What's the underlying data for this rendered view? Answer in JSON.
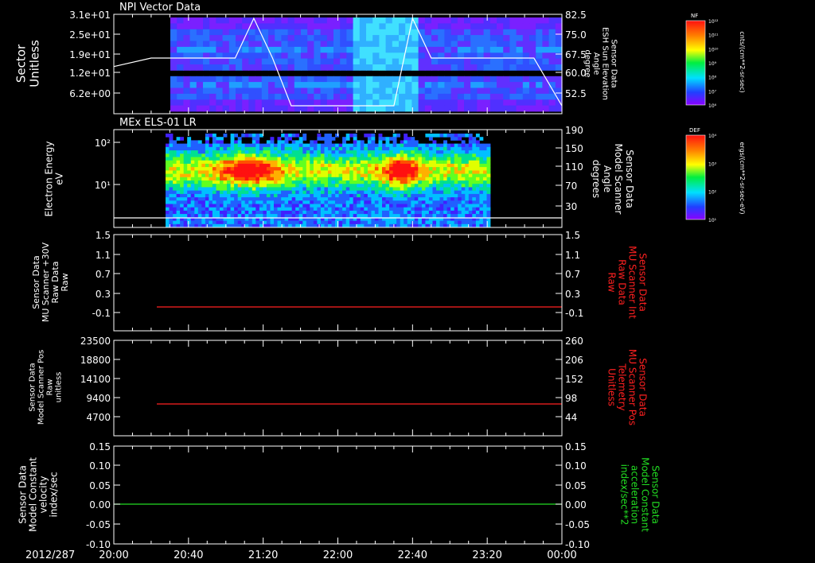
{
  "colors": {
    "background": "#000000",
    "axis": "#ffffff",
    "red_trace": "#ff2020",
    "green_trace": "#22dd22",
    "white_trace": "#ffffff"
  },
  "time_axis": {
    "date_label": "2012/287",
    "range": [
      "20:00",
      "00:00"
    ],
    "tick_labels": [
      "20:00",
      "20:40",
      "21:20",
      "22:00",
      "22:40",
      "23:20",
      "00:00"
    ]
  },
  "chart_data": [
    {
      "type": "heatmap",
      "title": "NPI Vector Data",
      "ylabel": "Sector\nUnitless",
      "y_ticks": [
        "3.1e+01",
        "2.5e+01",
        "1.9e+01",
        "1.2e+01",
        "6.2e+00"
      ],
      "y2label": "Sensor Data\nESH Sun Elevation\nAngle\ndegree",
      "y2_ticks": [
        "82.5",
        "75.0",
        "67.5",
        "60.0",
        "52.5"
      ],
      "overlay_line": {
        "color": "#ffffff",
        "description_points": [
          [
            "20:00",
            62.8
          ],
          [
            "20:20",
            66.0
          ],
          [
            "21:05",
            66.0
          ],
          [
            "21:15",
            81.0
          ],
          [
            "21:25",
            66.0
          ],
          [
            "21:35",
            48.0
          ],
          [
            "22:30",
            48.0
          ],
          [
            "22:40",
            81.0
          ],
          [
            "22:50",
            66.0
          ],
          [
            "23:45",
            66.0
          ],
          [
            "00:00",
            48.0
          ]
        ]
      },
      "colorbar": {
        "label": "NF",
        "units": "cnts/(cm**2-sr-sec)",
        "ticks": [
          "10¹²",
          "10¹¹",
          "10¹⁰",
          "10⁹",
          "10⁸",
          "10⁷",
          "10⁶"
        ]
      }
    },
    {
      "type": "heatmap",
      "title": "MEx ELS-01 LR",
      "ylabel": "Electron Energy\neV",
      "y_ticks": [
        "10²",
        "10¹"
      ],
      "y_scale": "log",
      "y2label": "Sensor Data\nModel Scanner\nAngle\ndegrees",
      "y2_ticks": [
        "190",
        "150",
        "110",
        "70",
        "30"
      ],
      "overlay_line": {
        "color": "#ffffff",
        "value": 20
      },
      "colorbar": {
        "label": "DEF",
        "units": "ergs/(cm**2-sr-sec-eV)",
        "ticks": [
          "10⁴",
          "10³",
          "10²",
          "10¹"
        ]
      }
    },
    {
      "type": "line",
      "ylabel": "Sensor Data\nMU Scanner +30V\nRaw Data\nRaw",
      "y_ticks": [
        "1.5",
        "1.1",
        "0.7",
        "0.3",
        "-0.1"
      ],
      "ylim": [
        -0.3,
        1.5
      ],
      "y2label": "Sensor Data\nMU Scanner Int\nRaw Data\nRaw",
      "y2_ticks": [
        "1.5",
        "1.1",
        "0.7",
        "0.3",
        "-0.1"
      ],
      "series": [
        {
          "color": "#ff2020",
          "x": [
            "20:20",
            "00:00"
          ],
          "values": [
            0.0,
            0.0
          ]
        }
      ]
    },
    {
      "type": "line",
      "ylabel": "Sensor Data\nModel Scanner Pos\nRaw\nunitless",
      "y_ticks": [
        "23500",
        "18800",
        "14100",
        "9400",
        "4700"
      ],
      "y2label": "Sensor Data\nMU Scanner Pos\nTelemetry\nUnitless",
      "y2_ticks": [
        "260",
        "206",
        "152",
        "98",
        "44"
      ],
      "series": [
        {
          "color": "#ff2020",
          "x": [
            "20:20",
            "00:00"
          ],
          "values": [
            7800,
            7800
          ]
        }
      ]
    },
    {
      "type": "line",
      "ylabel": "Sensor Data\nModel Constant\nvelocity\nindex/sec",
      "y_ticks": [
        "0.15",
        "0.10",
        "0.05",
        "0.00",
        "-0.05",
        "-0.10"
      ],
      "ylim": [
        -0.1,
        0.15
      ],
      "y2label": "Sensor Data\nModel Constant\nacceleration\nindex/sec**2",
      "y2_ticks": [
        "0.15",
        "0.10",
        "0.05",
        "0.00",
        "-0.05",
        "-0.10"
      ],
      "series": [
        {
          "color": "#22dd22",
          "x": [
            "20:00",
            "00:00"
          ],
          "values": [
            0.0,
            0.0
          ]
        }
      ]
    }
  ]
}
